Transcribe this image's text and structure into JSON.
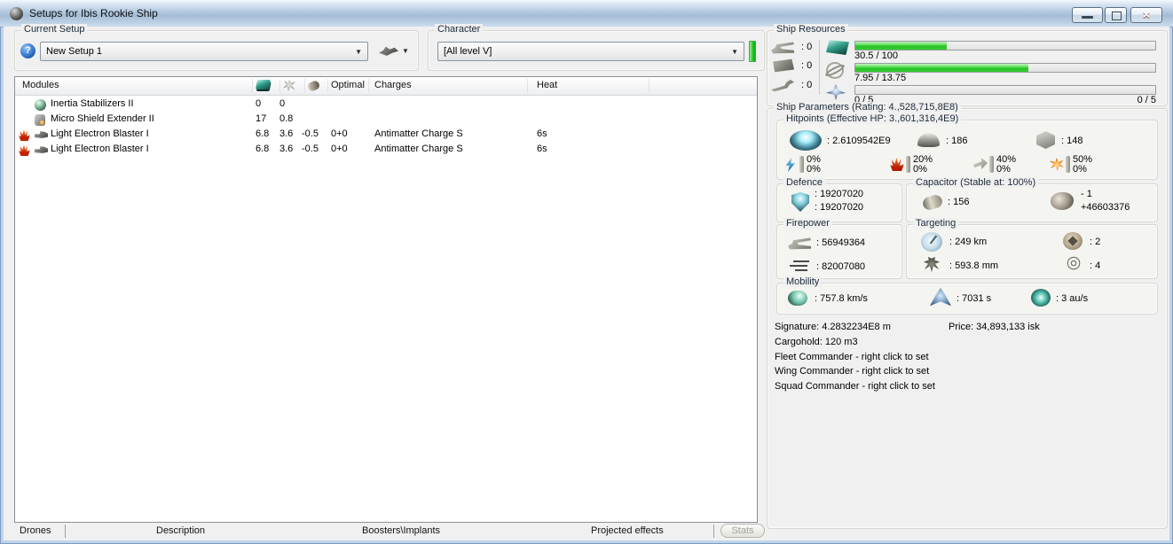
{
  "window": {
    "title": "Setups for Ibis Rookie Ship"
  },
  "setup": {
    "group_label": "Current Setup",
    "value": "New Setup 1"
  },
  "character": {
    "group_label": "Character",
    "value": "[All level V]"
  },
  "modules_table": {
    "col_modules": "Modules",
    "col_optimal": "Optimal",
    "col_charges": "Charges",
    "col_heat": "Heat",
    "rows": [
      {
        "icon": "inertia",
        "heated": false,
        "name": "Inertia Stabilizers II",
        "cpu": "0",
        "pg": "0",
        "cap": "",
        "optimal": "",
        "charges": "",
        "heat": ""
      },
      {
        "icon": "shieldext",
        "heated": false,
        "name": "Micro Shield Extender II",
        "cpu": "17",
        "pg": "0.8",
        "cap": "",
        "optimal": "",
        "charges": "",
        "heat": ""
      },
      {
        "icon": "blaster",
        "heated": true,
        "name": "Light Electron Blaster I",
        "cpu": "6.8",
        "pg": "3.6",
        "cap": "-0.5",
        "optimal": "0+0",
        "charges": "Antimatter Charge S",
        "heat": "6s"
      },
      {
        "icon": "blaster",
        "heated": true,
        "name": "Light Electron Blaster I",
        "cpu": "6.8",
        "pg": "3.6",
        "cap": "-0.5",
        "optimal": "0+0",
        "charges": "Antimatter Charge S",
        "heat": "6s"
      }
    ]
  },
  "ship_resources": {
    "group_label": "Ship Resources",
    "slots": [
      {
        "icon": "turret",
        "value": ": 0"
      },
      {
        "icon": "launcher",
        "value": ": 0"
      },
      {
        "icon": "rigs",
        "value": ": 0"
      }
    ],
    "bars": [
      {
        "icon": "cpu",
        "percent": 30.5,
        "text": "30.5 / 100",
        "right_text": ""
      },
      {
        "icon": "powergrid",
        "percent": 57.8,
        "text": "7.95 / 13.75",
        "right_text": ""
      },
      {
        "icon": "calibration",
        "percent": 0,
        "text": "0 / 5",
        "right_text": "0 / 5"
      }
    ]
  },
  "ship_parameters": {
    "group_label": "Ship Parameters (Rating: 4.,528,715,8E8)",
    "hitpoints": {
      "group_label": "Hitpoints (Effective HP: 3.,601,316,4E9)",
      "shield": ": 2.6109542E9",
      "armor": ": 186",
      "structure": ": 148",
      "resists": [
        {
          "icon": "em",
          "top": "0%",
          "bottom": "0%"
        },
        {
          "icon": "thermal",
          "top": "20%",
          "bottom": "0%"
        },
        {
          "icon": "kinetic",
          "top": "40%",
          "bottom": "0%"
        },
        {
          "icon": "explosive",
          "top": "50%",
          "bottom": "0%"
        }
      ]
    },
    "defence": {
      "group_label": "Defence",
      "line1": ": 19207020",
      "line2": ": 19207020"
    },
    "capacitor": {
      "group_label": "Capacitor (Stable at: 100%)",
      "capacity": ": 156",
      "delta": "- 1",
      "recharge": "+46603376"
    },
    "firepower": {
      "group_label": "Firepower",
      "dps": ": 56949364",
      "volley": ": 82007080"
    },
    "targeting": {
      "group_label": "Targeting",
      "range": ": 249 km",
      "signature_resolution": ": 593.8 mm",
      "max_targets": ": 2",
      "scan_resolution": ": 4"
    },
    "mobility": {
      "group_label": "Mobility",
      "speed": ": 757.8 km/s",
      "align_time": ": 7031 s",
      "warp_speed": ": 3 au/s"
    },
    "signature": "Signature: 4.2832234E8 m",
    "price": "Price: 34,893,133 isk",
    "cargohold": "Cargohold: 120 m3",
    "fleet_commander": "Fleet Commander - right click to set",
    "wing_commander": "Wing Commander - right click to set",
    "squad_commander": "Squad Commander - right click to set"
  },
  "bottom_bar": {
    "tabs": [
      "Drones",
      "Description",
      "Boosters\\Implants",
      "Projected effects"
    ],
    "stats_button": "Stats"
  }
}
